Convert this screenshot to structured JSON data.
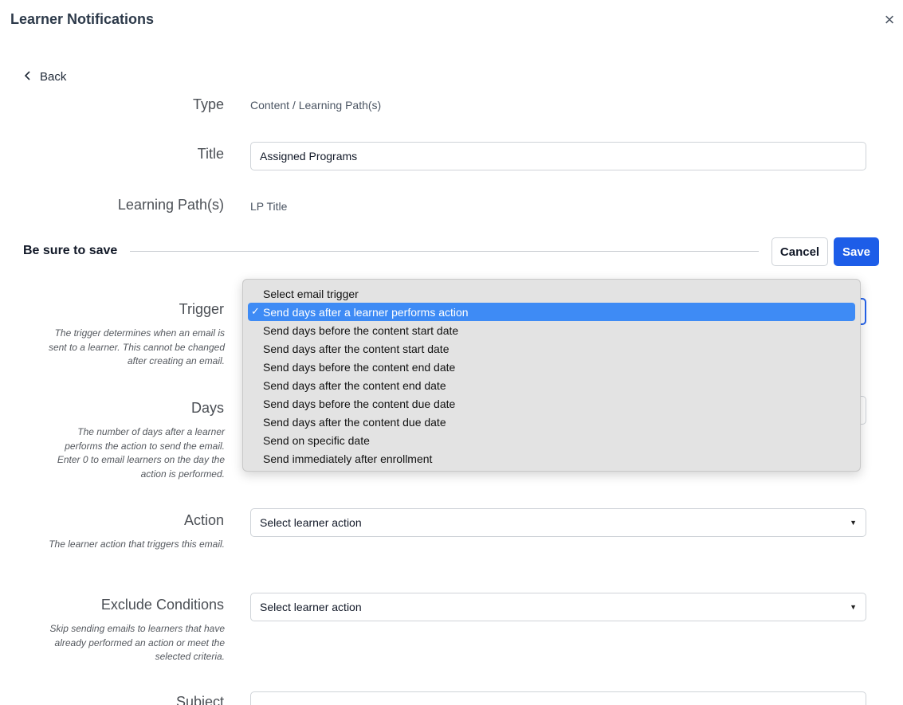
{
  "header": {
    "title": "Learner Notifications",
    "close_icon": "×"
  },
  "back": {
    "label": "Back"
  },
  "fields": {
    "type": {
      "label": "Type",
      "value": "Content / Learning Path(s)"
    },
    "title": {
      "label": "Title",
      "value": "Assigned Programs"
    },
    "learning_paths": {
      "label": "Learning Path(s)",
      "value": "LP Title"
    },
    "trigger": {
      "label": "Trigger",
      "help": "The trigger determines when an email is sent to a learner. This cannot be changed after creating an email."
    },
    "days": {
      "label": "Days",
      "help": "The number of days after a learner performs the action to send the email. Enter 0 to email learners on the day the action is performed."
    },
    "action": {
      "label": "Action",
      "value": "Select learner action",
      "help": "The learner action that triggers this email."
    },
    "exclude": {
      "label": "Exclude Conditions",
      "value": "Select learner action",
      "help": "Skip sending emails to learners that have already performed an action or meet the selected criteria."
    },
    "subject": {
      "label": "Subject"
    }
  },
  "save_bar": {
    "message": "Be sure to save",
    "cancel_label": "Cancel",
    "save_label": "Save"
  },
  "trigger_dropdown": {
    "selected_index": 1,
    "check_mark": "✓",
    "options": [
      "Select email trigger",
      "Send days after a learner performs action",
      "Send days before the content start date",
      "Send days after the content start date",
      "Send days before the content end date",
      "Send days after the content end date",
      "Send days before the content due date",
      "Send days after the content due date",
      "Send on specific date",
      "Send immediately after enrollment"
    ]
  },
  "colors": {
    "primary": "#1d5de8",
    "selected_option": "#3e8bf5",
    "title": "#2d3a4a"
  }
}
